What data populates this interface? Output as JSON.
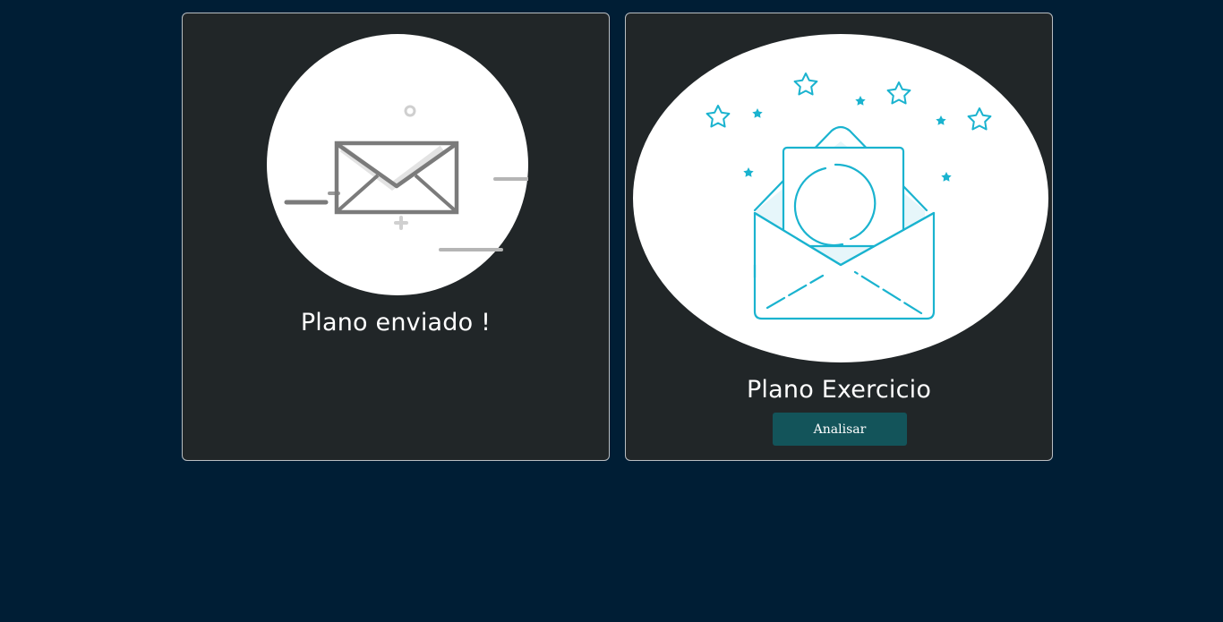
{
  "cards": [
    {
      "title": "Plano enviado !",
      "illustration": "envelope-sent-icon"
    },
    {
      "title": "Plano Exercicio",
      "illustration": "open-envelope-stars-icon",
      "button_label": "Analisar"
    }
  ],
  "colors": {
    "page_background": "#001e35",
    "card_background": "#212628",
    "card_border": "#b9bec2",
    "button_background": "#13545a",
    "accent_cyan": "#1ab3cf",
    "icon_gray": "#7b7b7b",
    "title_text": "#ffffff"
  }
}
